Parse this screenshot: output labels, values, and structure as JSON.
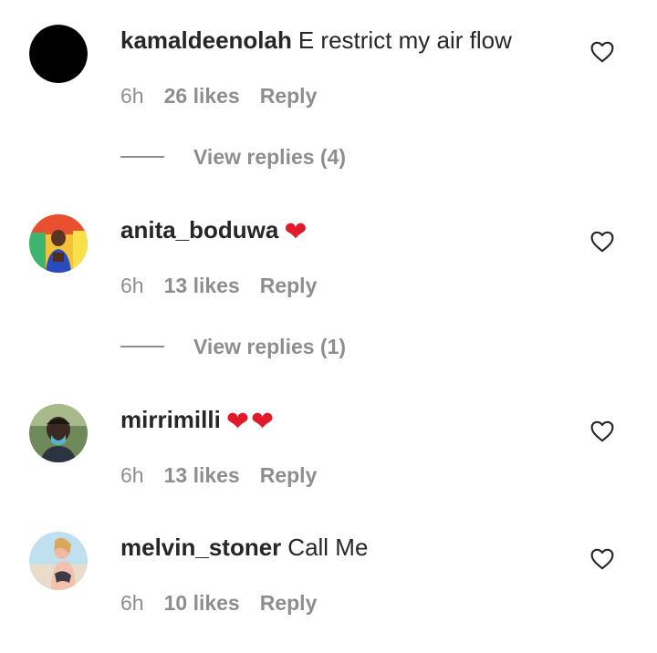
{
  "comments": [
    {
      "username": "kamaldeenolah",
      "text": "E restrict my air flow",
      "emoji": "",
      "time": "6h",
      "likes": "26 likes",
      "reply": "Reply",
      "view_replies": "View replies (4)",
      "avatar_color": "#000000"
    },
    {
      "username": "anita_boduwa",
      "text": "",
      "emoji": "❤",
      "time": "6h",
      "likes": "13 likes",
      "reply": "Reply",
      "view_replies": "View replies (1)"
    },
    {
      "username": "mirrimilli",
      "text": "",
      "emoji": "❤❤",
      "time": "6h",
      "likes": "13 likes",
      "reply": "Reply"
    },
    {
      "username": "melvin_stoner",
      "text": "Call Me",
      "emoji": "",
      "time": "6h",
      "likes": "10 likes",
      "reply": "Reply"
    }
  ],
  "colors": {
    "primary_text": "#262626",
    "secondary_text": "#8e8e8e",
    "heart_emoji": "#e0192b"
  },
  "icons": {
    "like": "heart-outline-icon"
  }
}
